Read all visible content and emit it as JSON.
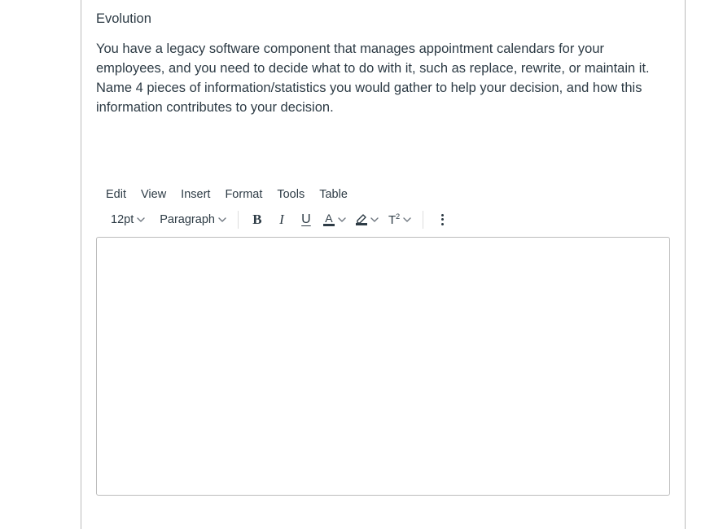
{
  "question": {
    "heading": "Evolution",
    "body": "You have a legacy software component that manages appointment calendars for your employees, and you need to decide what to do with it, such as replace, rewrite, or maintain it.  Name 4 pieces of information/statistics you would gather to help your decision, and how this information contributes to your decision."
  },
  "editor": {
    "menu": {
      "edit": "Edit",
      "view": "View",
      "insert": "Insert",
      "format": "Format",
      "tools": "Tools",
      "table": "Table"
    },
    "toolbar": {
      "fontsize": "12pt",
      "blockformat": "Paragraph"
    },
    "content": ""
  },
  "colors": {
    "text_color_bar": "#2d3b45",
    "highlight_bar": "#2d3b45"
  }
}
